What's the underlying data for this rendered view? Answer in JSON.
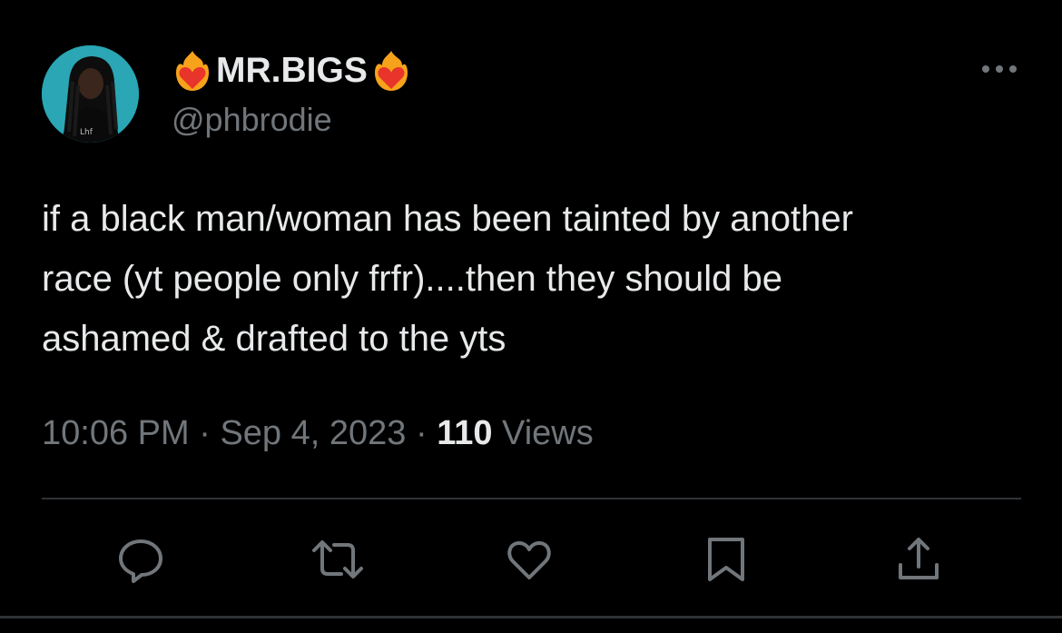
{
  "tweet": {
    "author": {
      "display_name": "MR.BIGS",
      "handle": "@phbrodie",
      "name_emoji": "fire-heart"
    },
    "text": "if a black man/woman has been tainted by another\nrace (yt people only frfr)....then they should be\nashamed & drafted to the yts",
    "meta": {
      "time": "10:06 PM",
      "separator": " · ",
      "date": "Sep 4, 2023",
      "views_count": "110",
      "views_label": " Views"
    },
    "actions": [
      {
        "name": "reply",
        "icon": "reply-icon"
      },
      {
        "name": "retweet",
        "icon": "retweet-icon"
      },
      {
        "name": "like",
        "icon": "heart-icon"
      },
      {
        "name": "bookmark",
        "icon": "bookmark-icon"
      },
      {
        "name": "share",
        "icon": "share-icon"
      }
    ]
  },
  "colors": {
    "background": "#000000",
    "primary_text": "#e7e9ea",
    "secondary_text": "#71767b",
    "divider": "#2f3336",
    "avatar_bg": "#2aa6b4",
    "fire_red": "#e8342a",
    "fire_orange": "#f7a21b"
  }
}
